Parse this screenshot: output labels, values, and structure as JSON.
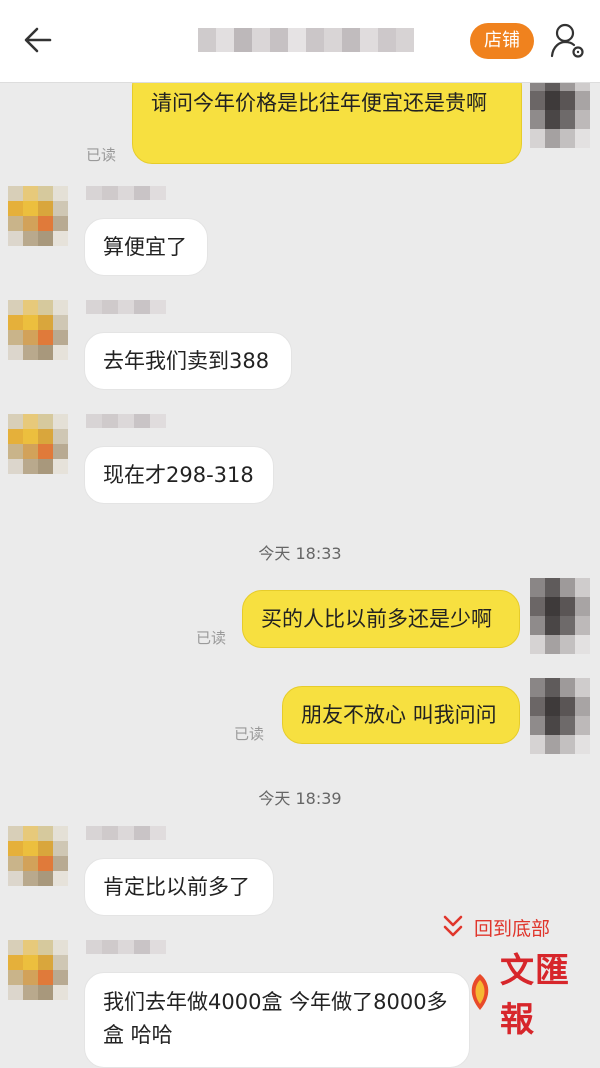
{
  "header": {
    "shop_label": "店铺"
  },
  "colors": {
    "accent": "#f0821e",
    "bubble_out": "#f7e040",
    "bubble_in": "#ffffff",
    "background": "#ebebeb",
    "link_red": "#e0362c"
  },
  "messages": {
    "m1": "请问今年价格是比往年便宜还是贵啊",
    "m2": "算便宜了",
    "m3": "去年我们卖到388",
    "m4": "现在才298-318",
    "m5": "买的人比以前多还是少啊",
    "m6": "朋友不放心 叫我问问",
    "m7": "肯定比以前多了",
    "m8": "我们去年做4000盒 今年做了8000多盒 哈哈"
  },
  "status": {
    "read": "已读"
  },
  "times": {
    "t1": "今天  18:33",
    "t2": "今天  18:39"
  },
  "footer": {
    "back_to_bottom": "回到底部",
    "watermark": "文匯報"
  }
}
